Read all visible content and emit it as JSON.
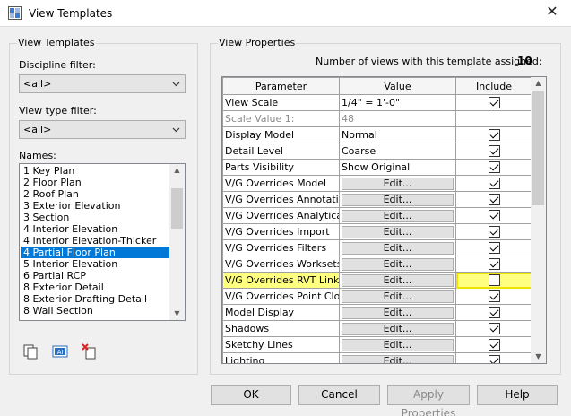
{
  "window": {
    "title": "View Templates",
    "close_glyph": "✕"
  },
  "left": {
    "group_title": "View Templates",
    "discipline_label": "Discipline filter:",
    "discipline_value": "<all>",
    "viewtype_label": "View type filter:",
    "viewtype_value": "<all>",
    "names_label": "Names:",
    "names": [
      "1 Key Plan",
      "2 Floor Plan",
      "2 Roof Plan",
      "3 Exterior Elevation",
      "3 Section",
      "4 Interior Elevation",
      "4 Interior Elevation-Thicker",
      "4 Partial Floor Plan",
      "5 Interior Elevation",
      "6 Partial RCP",
      "8 Exterior Detail",
      "8 Exterior Drafting Detail",
      "8 Wall Section"
    ],
    "selected_name": "4 Partial Floor Plan",
    "tools": [
      "duplicate-icon",
      "rename-icon",
      "delete-icon"
    ]
  },
  "right": {
    "group_title": "View Properties",
    "count_label": "Number of views with this template assigned:",
    "count_value": "10",
    "columns": {
      "parameter": "Parameter",
      "value": "Value",
      "include": "Include"
    },
    "rows": [
      {
        "parameter": "View Scale",
        "value": "1/4\" = 1'-0\"",
        "kind": "text",
        "include": true
      },
      {
        "parameter": "Scale Value    1:",
        "value": "48",
        "kind": "grey",
        "include": null
      },
      {
        "parameter": "Display Model",
        "value": "Normal",
        "kind": "text",
        "include": true
      },
      {
        "parameter": "Detail Level",
        "value": "Coarse",
        "kind": "text",
        "include": true
      },
      {
        "parameter": "Parts Visibility",
        "value": "Show Original",
        "kind": "text",
        "include": true
      },
      {
        "parameter": "V/G Overrides Model",
        "value": "Edit...",
        "kind": "button",
        "include": true
      },
      {
        "parameter": "V/G Overrides Annotati",
        "value": "Edit...",
        "kind": "button",
        "include": true
      },
      {
        "parameter": "V/G Overrides Analytica",
        "value": "Edit...",
        "kind": "button",
        "include": true
      },
      {
        "parameter": "V/G Overrides Import",
        "value": "Edit...",
        "kind": "button",
        "include": true
      },
      {
        "parameter": "V/G Overrides Filters",
        "value": "Edit...",
        "kind": "button",
        "include": true
      },
      {
        "parameter": "V/G Overrides Worksets",
        "value": "Edit...",
        "kind": "button",
        "include": true
      },
      {
        "parameter": "V/G Overrides RVT Links",
        "value": "Edit...",
        "kind": "button",
        "include": false,
        "highlight": true
      },
      {
        "parameter": "V/G Overrides Point Clo",
        "value": "Edit...",
        "kind": "button",
        "include": true
      },
      {
        "parameter": "Model Display",
        "value": "Edit...",
        "kind": "button",
        "include": true
      },
      {
        "parameter": "Shadows",
        "value": "Edit...",
        "kind": "button",
        "include": true
      },
      {
        "parameter": "Sketchy Lines",
        "value": "Edit...",
        "kind": "button",
        "include": true
      },
      {
        "parameter": "Lighting",
        "value": "Edit...",
        "kind": "button",
        "include": true
      }
    ]
  },
  "buttons": {
    "ok": "OK",
    "cancel": "Cancel",
    "apply": "Apply Properties",
    "help": "Help"
  },
  "colors": {
    "selection": "#0078d7",
    "highlight": "#ffff80",
    "highlight_border": "#f2e200"
  }
}
